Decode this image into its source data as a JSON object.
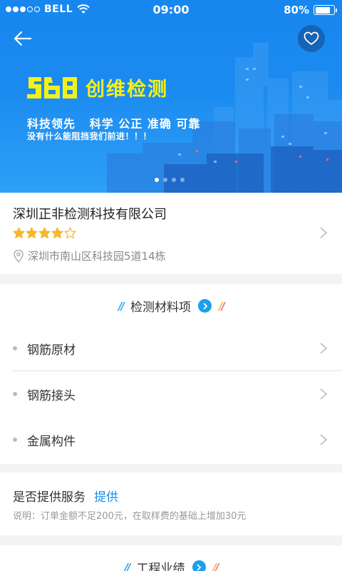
{
  "status_bar": {
    "carrier": "BELL",
    "time": "09:00",
    "battery_percent": "80%",
    "battery_level": 0.8,
    "signal_bars_filled": 3,
    "signal_bars_total": 5
  },
  "banner": {
    "brand_name": "创维检测",
    "slogan": "科技领先   科学 公正 准确 可靠",
    "tagline": "没有什么能阻挡我们前进！！！",
    "page_count": 4,
    "active_page": 1,
    "icons": {
      "back": "arrow-left-icon",
      "favorite": "heart-outline-icon"
    }
  },
  "company": {
    "name": "深圳正非检测科技有限公司",
    "rating": 4,
    "rating_max": 5,
    "address": "深圳市南山区科技园5道14栋",
    "icons": {
      "location": "location-pin-icon",
      "chevron": "chevron-right-icon"
    }
  },
  "materials": {
    "title": "检测材料项",
    "items": [
      {
        "label": "钢筋原材"
      },
      {
        "label": "钢筋接头"
      },
      {
        "label": "金属构件"
      }
    ]
  },
  "service": {
    "label": "是否提供服务",
    "value": "提供",
    "note": "说明：订单金额不足200元，在取样费的基础上增加30元"
  },
  "projects": {
    "title": "工程业绩"
  },
  "colors": {
    "banner_blue": "#1787ef",
    "brand_yellow": "#f5f118",
    "accent_blue": "#1aa0ee",
    "link_blue": "#1d8fe8",
    "star_gold": "#f5b82a"
  }
}
